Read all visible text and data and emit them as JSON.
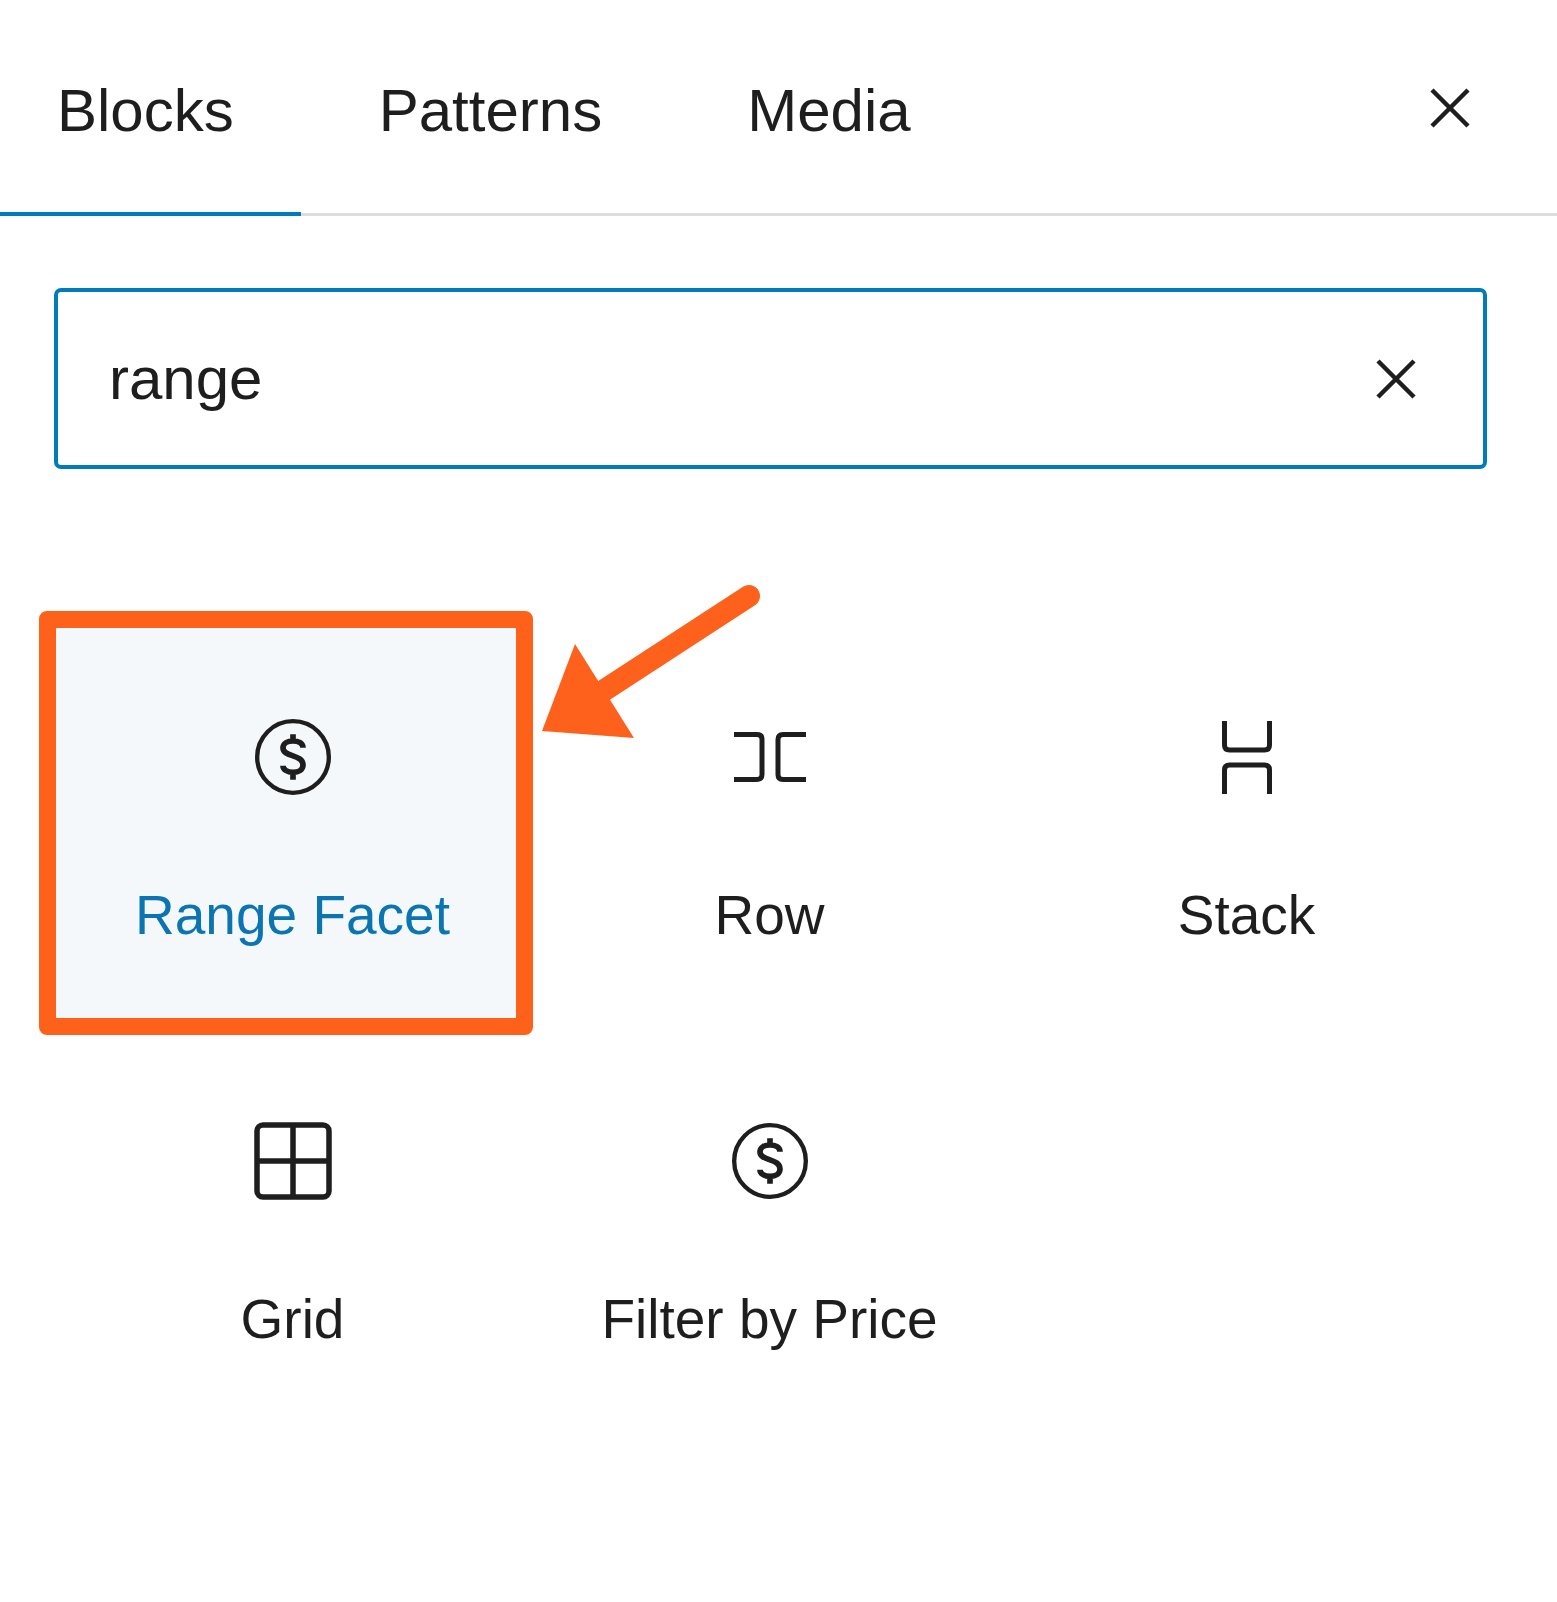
{
  "tabs": [
    {
      "label": "Blocks",
      "selected": true
    },
    {
      "label": "Patterns",
      "selected": false
    },
    {
      "label": "Media",
      "selected": false
    }
  ],
  "search": {
    "value": "range"
  },
  "blocks": [
    {
      "label": "Range Facet",
      "kind": "currency",
      "selected": true,
      "highlighted": true
    },
    {
      "label": "Row",
      "kind": "row",
      "selected": false,
      "highlighted": false
    },
    {
      "label": "Stack",
      "kind": "stack",
      "selected": false,
      "highlighted": false
    },
    {
      "label": "Grid",
      "kind": "grid",
      "selected": false,
      "highlighted": false
    },
    {
      "label": "Filter by Price",
      "kind": "currency",
      "selected": false,
      "highlighted": false
    }
  ]
}
